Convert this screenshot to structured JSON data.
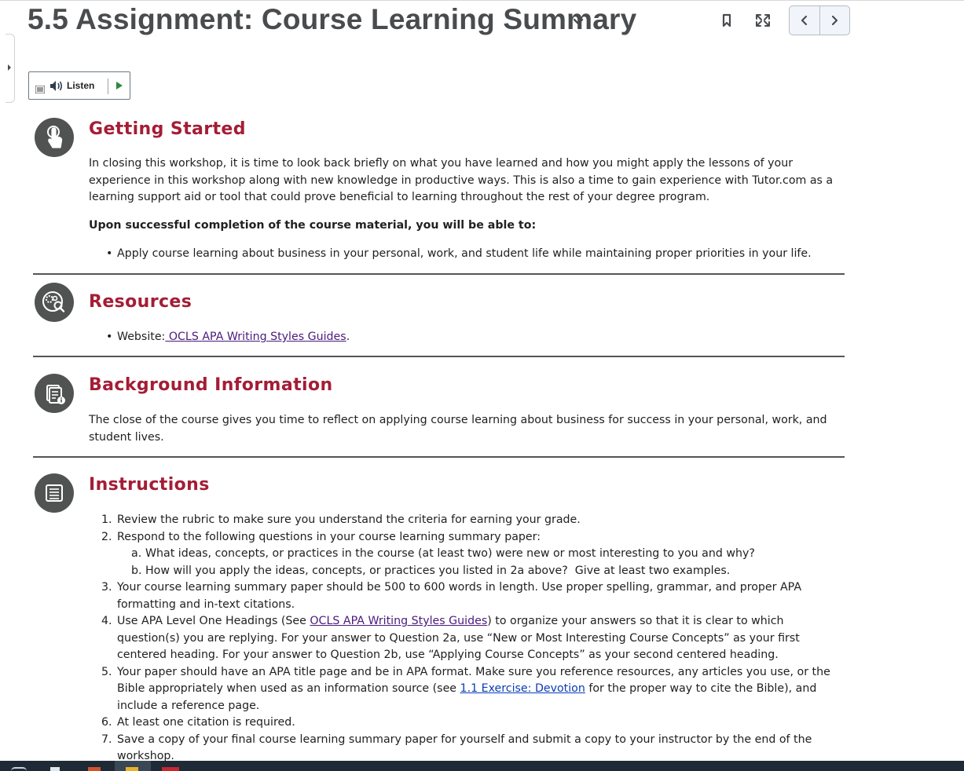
{
  "page": {
    "title": "5.5 Assignment: Course Learning Summary"
  },
  "toolbar": {
    "listen_label": "Listen"
  },
  "sections": {
    "getting_started": {
      "title": "Getting Started",
      "intro": "In closing this workshop, it is time to look back briefly on what you have learned and how you might apply the lessons of your experience in this workshop along with new knowledge in productive ways. This is also a time to gain experience with Tutor.com as a learning support aid or tool that could prove beneficial to learning throughout the rest of your degree program.",
      "objectives_heading": "Upon successful completion of the course material, you will be able to:",
      "objectives": [
        "Apply course learning about business in your personal, work, and student life while maintaining proper priorities in your life."
      ]
    },
    "resources": {
      "title": "Resources",
      "website_prefix": "Website:",
      "website_link": " OCLS APA Writing Styles Guides",
      "website_suffix": "."
    },
    "background": {
      "title": "Background Information",
      "text": "The close of the course gives you time to reflect on applying course learning about business for success in your personal, work, and student lives."
    },
    "instructions": {
      "title": "Instructions",
      "items": [
        {
          "num": "1.",
          "text": "Review the rubric to make sure you understand the criteria for earning your grade."
        },
        {
          "num": "2.",
          "text": "Respond to the following questions in your course learning summary paper:"
        },
        {
          "num": "a.",
          "text": "What ideas, concepts, or practices in the course (at least two) were new or most interesting to you and why?"
        },
        {
          "num": "b.",
          "text": "How will you apply the ideas, concepts, or practices you listed in 2a above?  Give at least two examples."
        },
        {
          "num": "3.",
          "text": "Your course learning summary paper should be 500 to 600 words in length. Use proper spelling, grammar, and proper APA formatting and in-text citations."
        },
        {
          "num": "4.",
          "pre": "Use APA Level One Headings (See ",
          "link": "OCLS APA Writing Styles Guides",
          "post": ") to organize your answers so that it is clear to which question(s) you are replying. For your answer to Question 2a, use “New or Most Interesting Course Concepts” as your first centered heading. For your answer to Question 2b, use “Applying Course Concepts” as your second centered heading."
        },
        {
          "num": "5.",
          "pre": "Your paper should have an APA title page and be in APA format. Make sure you reference resources, any articles you use, or the Bible appropriately when used as an information source (see ",
          "link": "1.1 Exercise: Devotion",
          "post": " for the proper way to cite the Bible), and include a reference page."
        },
        {
          "num": "6.",
          "text": "At least one citation is required."
        },
        {
          "num": "7.",
          "text": "Save a copy of your final course learning summary paper for yourself and submit a copy to your instructor by the end of the workshop."
        }
      ]
    }
  },
  "colors": {
    "heading": "#a41d35",
    "icon_circle": "#515353",
    "link_visited": "#4b1a7c",
    "link": "#0b3bb8"
  }
}
